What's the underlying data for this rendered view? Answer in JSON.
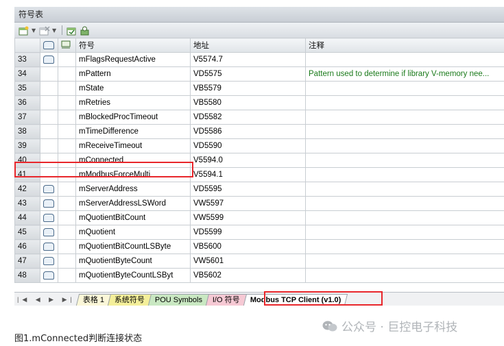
{
  "window": {
    "title": "符号表"
  },
  "toolbar": {
    "icons": [
      "new-table-icon",
      "delete-table-icon",
      "create-symbols-icon",
      "apply-icon"
    ]
  },
  "table": {
    "headers": [
      "",
      "",
      "",
      "符号",
      "地址",
      "注释"
    ],
    "rows": [
      {
        "num": "33",
        "icon": true,
        "symbol": "mFlagsRequestActive",
        "address": "V5574.7",
        "comment": ""
      },
      {
        "num": "34",
        "icon": false,
        "symbol": "mPattern",
        "address": "VD5575",
        "comment": "Pattern used to determine if library V-memory nee..."
      },
      {
        "num": "35",
        "icon": false,
        "symbol": "mState",
        "address": "VB5579",
        "comment": ""
      },
      {
        "num": "36",
        "icon": false,
        "symbol": "mRetries",
        "address": "VB5580",
        "comment": ""
      },
      {
        "num": "37",
        "icon": false,
        "symbol": "mBlockedProcTimeout",
        "address": "VD5582",
        "comment": ""
      },
      {
        "num": "38",
        "icon": false,
        "symbol": "mTimeDifference",
        "address": "VD5586",
        "comment": ""
      },
      {
        "num": "39",
        "icon": false,
        "symbol": "mReceiveTimeout",
        "address": "VD5590",
        "comment": ""
      },
      {
        "num": "40",
        "icon": false,
        "symbol": "mConnected",
        "address": "V5594.0",
        "comment": ""
      },
      {
        "num": "41",
        "icon": false,
        "symbol": "mModbusForceMulti",
        "address": "V5594.1",
        "comment": ""
      },
      {
        "num": "42",
        "icon": true,
        "symbol": "mServerAddress",
        "address": "VD5595",
        "comment": ""
      },
      {
        "num": "43",
        "icon": true,
        "symbol": "mServerAddressLSWord",
        "address": "VW5597",
        "comment": ""
      },
      {
        "num": "44",
        "icon": true,
        "symbol": "mQuotientBitCount",
        "address": "VW5599",
        "comment": ""
      },
      {
        "num": "45",
        "icon": true,
        "symbol": "mQuotient",
        "address": "VD5599",
        "comment": ""
      },
      {
        "num": "46",
        "icon": true,
        "symbol": "mQuotientBitCountLSByte",
        "address": "VB5600",
        "comment": ""
      },
      {
        "num": "47",
        "icon": true,
        "symbol": "mQuotientByteCount",
        "address": "VW5601",
        "comment": ""
      },
      {
        "num": "48",
        "icon": true,
        "symbol": "mQuotientByteCountLSByt",
        "address": "VB5602",
        "comment": ""
      }
    ]
  },
  "tabs": [
    {
      "label": "表格 1"
    },
    {
      "label": "系统符号"
    },
    {
      "label": "POU Symbols"
    },
    {
      "label": "I/O 符号"
    },
    {
      "label": "Modbus TCP Client (v1.0)"
    }
  ],
  "nav_arrows": "|◀ ◀ ▶ ▶|",
  "caption": "图1.mConnected判断连接状态",
  "watermark": "公众号 · 巨控电子科技",
  "colors": {
    "highlight": "#e8262b",
    "comment_text": "#1a7a1a"
  }
}
